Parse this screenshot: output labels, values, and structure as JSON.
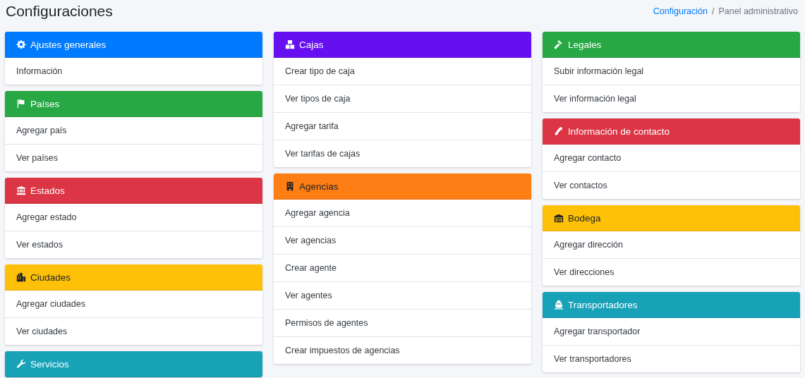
{
  "page_title": "Configuraciones",
  "breadcrumb": [
    {
      "label": "Configuración",
      "link": true
    },
    {
      "label": "/",
      "link": false
    },
    {
      "label": "Panel administrativo",
      "link": false
    }
  ],
  "columns": [
    {
      "cards": [
        {
          "title": "Ajustes generales",
          "color": "#007bff",
          "items": [
            "Información"
          ]
        },
        {
          "title": "Países",
          "color": "#28a745",
          "items": [
            "Agregar país",
            "Ver países"
          ]
        },
        {
          "title": "Estados",
          "color": "#dc3545",
          "items": [
            "Agregar estado",
            "Ver estados"
          ]
        },
        {
          "title": "Ciudades",
          "color": "#ffc107",
          "items": [
            "Agregar ciudades",
            "Ver ciudades"
          ]
        },
        {
          "title": "Servicios",
          "color": "#17a2b8"
        }
      ]
    },
    {
      "cards": [
        {
          "title": "Cajas",
          "color": "#6610f2",
          "items": [
            "Crear tipo de caja",
            "Ver tipos de caja",
            "Agregar tarifa",
            "Ver tarifas de cajas"
          ]
        },
        {
          "title": "Agencias",
          "color": "#fd7e14",
          "items": [
            "Agregar agencia",
            "Ver agencias",
            "Crear agente",
            "Ver agentes",
            "Permisos de agentes",
            "Crear impuestos de agencias"
          ]
        }
      ]
    },
    {
      "cards": [
        {
          "title": "Legales",
          "color": "#28a745",
          "items": [
            "Subir información legal",
            "Ver información legal"
          ]
        },
        {
          "title": "Información de contacto",
          "color": "#dc3545",
          "items": [
            "Agregar contacto",
            "Ver contactos"
          ]
        },
        {
          "title": "Bodega",
          "color": "#ffc107",
          "items": [
            "Agregar dirección",
            "Ver direcciones"
          ]
        },
        {
          "title": "Transportadores",
          "color": "#17a2b8",
          "items": [
            "Agregar transportador",
            "Ver transportadores"
          ]
        }
      ]
    }
  ]
}
